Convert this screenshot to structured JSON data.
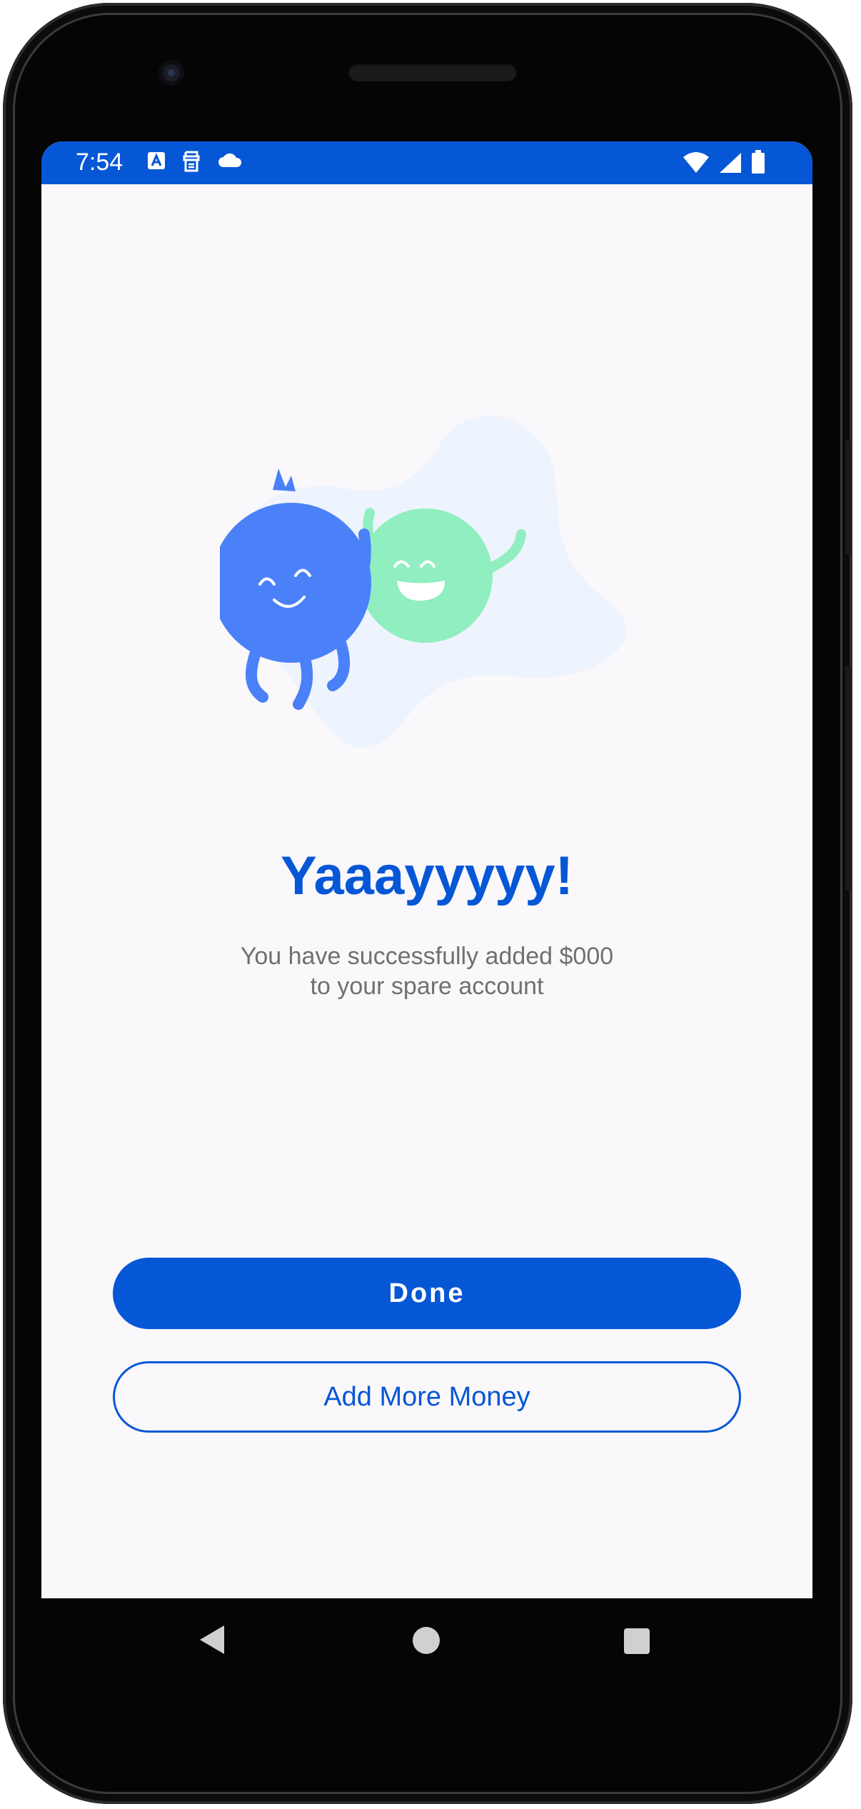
{
  "status_bar": {
    "time": "7:54",
    "left_icons": [
      "text-a-icon",
      "sim-icon",
      "cloud-icon"
    ],
    "right_icons": [
      "wifi-icon",
      "signal-icon",
      "battery-icon"
    ],
    "color": "#0657d6"
  },
  "illustration": {
    "name": "two-happy-characters",
    "colors": {
      "blue_character": "#4a80f8",
      "green_character": "#90eec0",
      "blob": "#eef4fd"
    }
  },
  "main": {
    "title": "Yaaayyyyy!",
    "message_line1": "You have successfully added $000",
    "message_line2": "to your spare account"
  },
  "actions": {
    "done_label": "Done",
    "add_more_label": "Add More Money"
  },
  "navigation": {
    "icons": [
      "back-icon",
      "home-icon",
      "recents-icon"
    ]
  },
  "theme": {
    "accent": "#0657d6",
    "background": "#faf8fb",
    "text_secondary": "#707070"
  }
}
